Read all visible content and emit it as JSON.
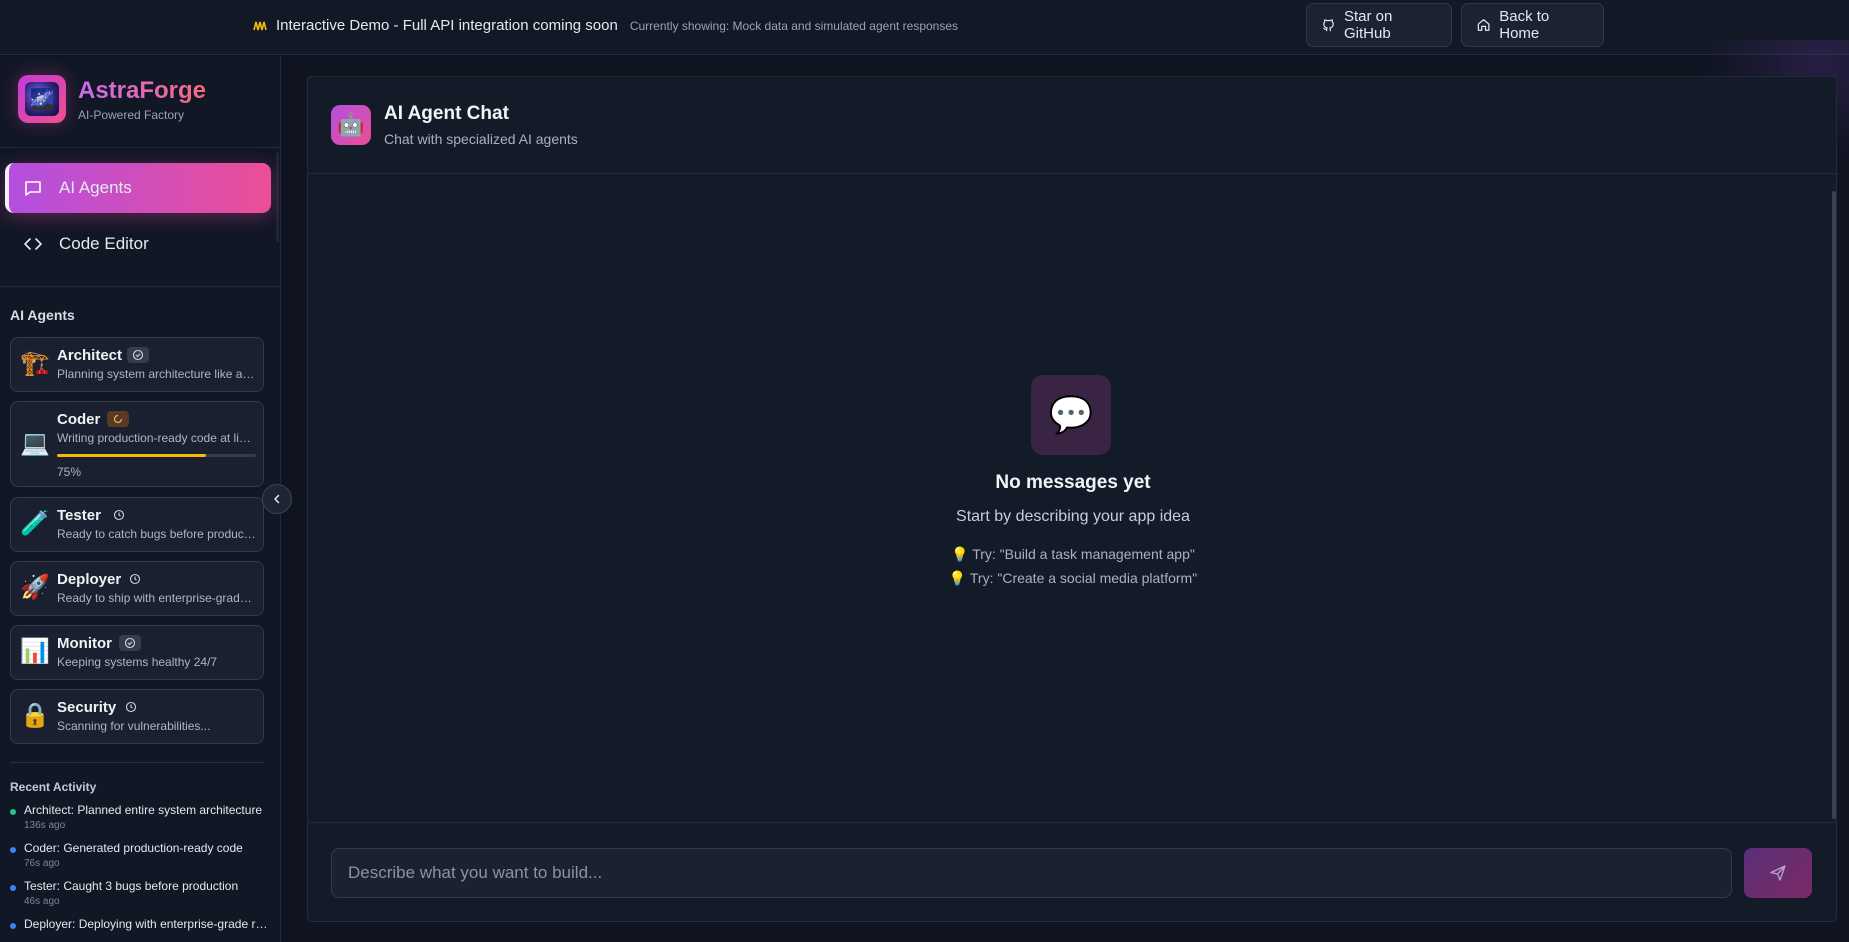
{
  "banner": {
    "icon": "wave-icon",
    "title": "Interactive Demo - Full API integration coming soon",
    "subtitle": "Currently showing: Mock data and simulated agent responses",
    "github_label": "Star on GitHub",
    "home_label": "Back to Home"
  },
  "brand": {
    "name": "AstraForge",
    "tagline": "AI-Powered Factory"
  },
  "nav": [
    {
      "label": "AI Agents",
      "icon": "message-square-icon",
      "active": true
    },
    {
      "label": "Code Editor",
      "icon": "code-icon",
      "active": false
    }
  ],
  "agents_section": {
    "title": "AI Agents",
    "agents": [
      {
        "emoji": "🏗️",
        "name": "Architect",
        "status": "done",
        "description": "Planning system architecture like a senior engineer"
      },
      {
        "emoji": "💻",
        "name": "Coder",
        "status": "working",
        "description": "Writing production-ready code at lightning speed",
        "progress": 0.75,
        "progress_label": "75%"
      },
      {
        "emoji": "🧪",
        "name": "Tester",
        "status": "idle",
        "description": "Ready to catch bugs before production"
      },
      {
        "emoji": "🚀",
        "name": "Deployer",
        "status": "idle",
        "description": "Ready to ship with enterprise-grade reliability"
      },
      {
        "emoji": "📊",
        "name": "Monitor",
        "status": "done",
        "description": "Keeping systems healthy 24/7"
      },
      {
        "emoji": "🔒",
        "name": "Security",
        "status": "idle",
        "description": "Scanning for vulnerabilities..."
      }
    ]
  },
  "activity": {
    "title": "Recent Activity",
    "items": [
      {
        "text": "Architect: Planned entire system architecture",
        "time": "136s ago",
        "color": "#22c58a"
      },
      {
        "text": "Coder: Generated production-ready code",
        "time": "76s ago",
        "color": "#3b82f6"
      },
      {
        "text": "Tester: Caught 3 bugs before production",
        "time": "46s ago",
        "color": "#3b82f6"
      },
      {
        "text": "Deployer: Deploying with enterprise-grade reliability",
        "time": "",
        "color": "#3b82f6"
      }
    ]
  },
  "chat": {
    "avatar": "🤖",
    "title": "AI Agent Chat",
    "subtitle": "Chat with specialized AI agents",
    "empty_icon": "💬",
    "empty_title": "No messages yet",
    "empty_subtitle": "Start by describing your app idea",
    "tips": [
      "💡 Try: \"Build a task management app\"",
      "💡 Try: \"Create a social media platform\""
    ],
    "input_placeholder": "Describe what you want to build...",
    "input_value": ""
  },
  "colors": {
    "accent_start": "#b34fe0",
    "accent_end": "#ec4e96",
    "progress": "#f5b90b",
    "background": "#0f1420"
  }
}
